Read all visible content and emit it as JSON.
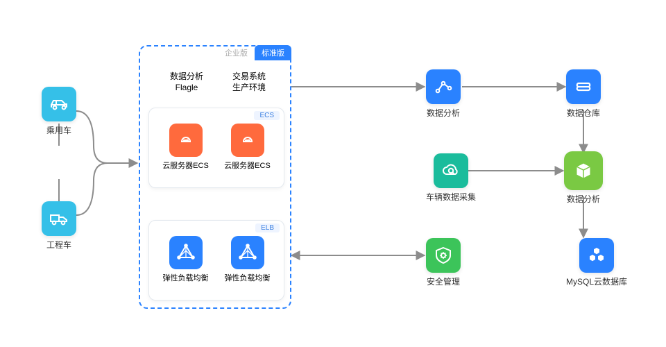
{
  "left": {
    "car": {
      "label": "乘用车"
    },
    "truck": {
      "label": "工程车"
    }
  },
  "center_box": {
    "tabs": {
      "active": "标准版",
      "other": "企业版"
    },
    "row1_left": {
      "line1": "数据分析",
      "line2": "Flagle"
    },
    "row1_right": {
      "line1": "交易系统",
      "line2": "生产环境"
    },
    "ecs": {
      "badge": "ECS",
      "item1": "云服务器ECS",
      "item2": "云服务器ECS"
    },
    "elb": {
      "badge": "ELB",
      "item1": "弹性负载均衡",
      "item2": "弹性负载均衡"
    }
  },
  "col2": {
    "top": {
      "label": "数据分析"
    },
    "mid": {
      "label": "车辆数据采集"
    },
    "bottom": {
      "label": "安全管理"
    }
  },
  "col3": {
    "top": {
      "label": "数据仓库"
    },
    "mid": {
      "label": "数据分析"
    },
    "bottom": {
      "label": "MySQL云数据库"
    }
  }
}
